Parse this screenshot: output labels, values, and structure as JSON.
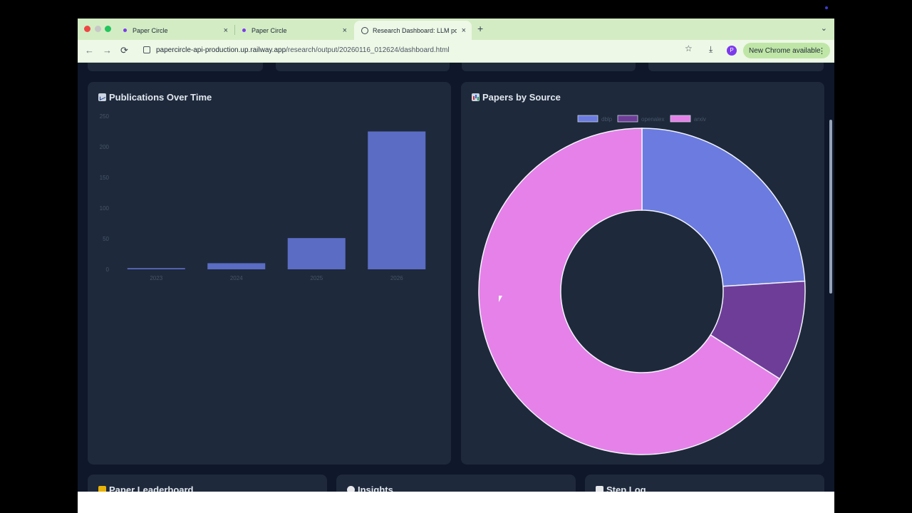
{
  "browser": {
    "tabs": [
      {
        "label": "Paper Circle",
        "icon": "favicon-dot-icon",
        "active": false
      },
      {
        "label": "Paper Circle",
        "icon": "favicon-dot-icon",
        "active": false
      },
      {
        "label": "Research Dashboard: LLM po",
        "icon": "globe-icon",
        "active": true
      }
    ],
    "tab_close": "×",
    "new_tab": "+",
    "url_host": "papercircle-api-production.up.railway.app",
    "url_path": "/research/output/20260116_012624/dashboard.html",
    "avatar_letter": "P",
    "update_label": "New Chrome available",
    "nav": {
      "back": "←",
      "forward": "→",
      "reload": "⟳"
    }
  },
  "cards": {
    "publications": {
      "title": "Publications Over Time",
      "icon": "line-chart-icon"
    },
    "sources": {
      "title": "Papers by Source",
      "icon": "bar-chart-icon"
    },
    "leaderboard": {
      "title": "Paper Leaderboard",
      "icon": "trophy-icon"
    },
    "insights": {
      "title": "Insights",
      "icon": "bulb-icon"
    },
    "steplog": {
      "title": "Step Log",
      "icon": "notepad-icon"
    }
  },
  "colors": {
    "bar": "#5b6cc4",
    "slice1": "#6b7be0",
    "slice2": "#6e3d98",
    "slice3": "#e581e9",
    "card_bg": "#1e293b",
    "page_bg": "#0f172a"
  },
  "chart_data": [
    {
      "type": "bar",
      "categories": [
        "2023",
        "2024",
        "2025",
        "2026"
      ],
      "values": [
        2,
        10,
        51,
        225
      ],
      "title": "Publications Over Time",
      "xlabel": "",
      "ylabel": "",
      "ylim": [
        0,
        250
      ],
      "yticks": [
        0,
        50,
        100,
        150,
        200,
        250
      ],
      "grid": false
    },
    {
      "type": "pie",
      "variant": "doughnut",
      "labels": [
        "dblp",
        "openalex",
        "arxiv"
      ],
      "values": [
        24,
        10,
        66
      ],
      "title": "Papers by Source",
      "legend": "top"
    }
  ]
}
